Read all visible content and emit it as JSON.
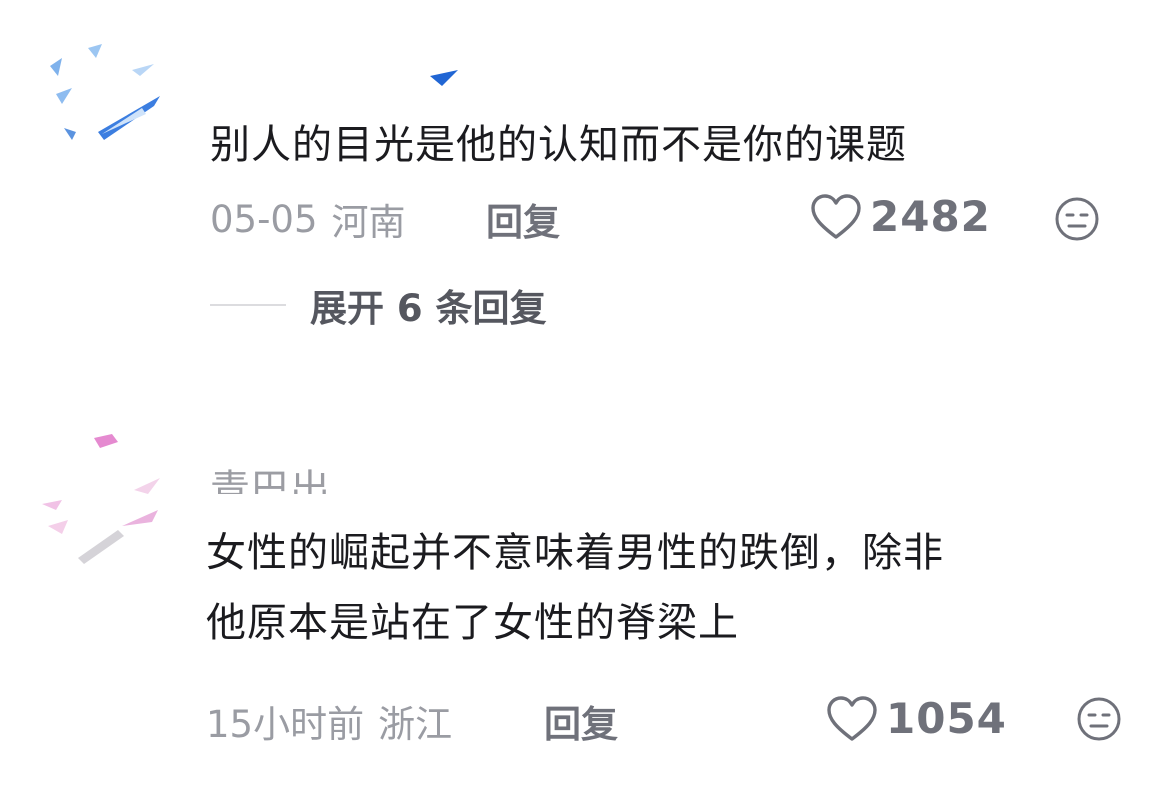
{
  "comments": [
    {
      "text": "别人的目光是他的认知而不是你的课题",
      "date": "05-05",
      "region": "河南",
      "reply_label": "回复",
      "likes": "2482",
      "expand_label": "展开 6 条回复"
    },
    {
      "username_fragment": "青巴出",
      "text_line1": "女性的崛起并不意味着男性的跌倒，除非",
      "text_line2": "他原本是站在了女性的脊梁上",
      "date": "15小时前",
      "region": "浙江",
      "reply_label": "回复",
      "likes": "1054"
    }
  ],
  "icons": {
    "like": "heart-outline-icon",
    "dislike": "neutral-face-icon"
  },
  "colors": {
    "text_primary": "#1b1b1f",
    "text_meta": "#9a9ca3",
    "text_action": "#6f717a",
    "avatar1_accent": "#2f6fd6",
    "avatar2_accent": "#e58ad0"
  }
}
